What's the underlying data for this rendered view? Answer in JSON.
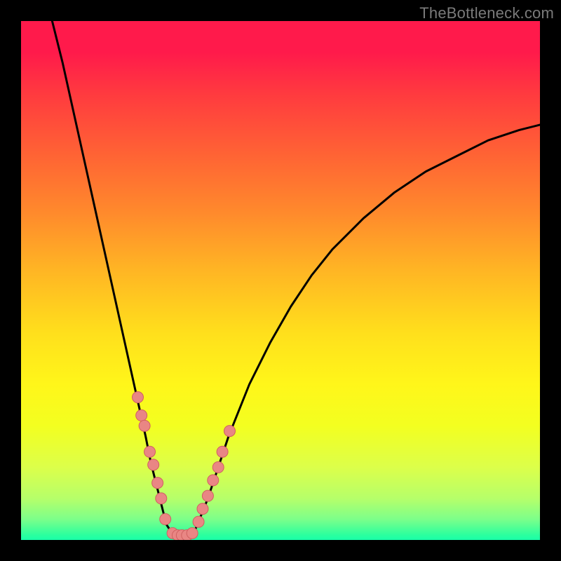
{
  "watermark": "TheBottleneck.com",
  "chart_data": {
    "type": "line",
    "title": "",
    "xlabel": "",
    "ylabel": "",
    "xlim": [
      0,
      100
    ],
    "ylim": [
      0,
      100
    ],
    "curve_left": {
      "x": [
        6,
        8,
        10,
        12,
        14,
        16,
        18,
        20,
        22,
        24,
        25,
        26,
        27,
        28,
        29.5
      ],
      "y": [
        100,
        92,
        83,
        74,
        65,
        56,
        47,
        38,
        29,
        20,
        15,
        11,
        7,
        3,
        0.7
      ]
    },
    "curve_right": {
      "x": [
        33,
        34,
        36,
        38,
        40,
        44,
        48,
        52,
        56,
        60,
        66,
        72,
        78,
        84,
        90,
        96,
        100
      ],
      "y": [
        0.7,
        3,
        8,
        14,
        20,
        30,
        38,
        45,
        51,
        56,
        62,
        67,
        71,
        74,
        77,
        79,
        80
      ]
    },
    "curve_bottom": {
      "x": [
        29.5,
        30,
        31,
        32,
        33
      ],
      "y": [
        0.7,
        0.5,
        0.5,
        0.5,
        0.7
      ]
    },
    "markers_left": {
      "x": [
        22.5,
        23.2,
        23.8,
        24.8,
        25.5,
        26.3,
        27.0,
        27.8
      ],
      "y": [
        27.5,
        24.0,
        22.0,
        17.0,
        14.5,
        11.0,
        8.0,
        4.0
      ]
    },
    "markers_right": {
      "x": [
        34.2,
        35.0,
        36.0,
        37.0,
        38.0,
        38.8,
        40.2
      ],
      "y": [
        3.5,
        6.0,
        8.5,
        11.5,
        14.0,
        17.0,
        21.0
      ]
    },
    "markers_bottom": {
      "x": [
        29.2,
        30.2,
        31.0,
        32.0,
        33.0
      ],
      "y": [
        1.3,
        0.9,
        0.9,
        0.9,
        1.3
      ]
    },
    "colors": {
      "curve": "#000000",
      "marker_fill": "#e98684",
      "marker_stroke": "#d06060"
    }
  }
}
